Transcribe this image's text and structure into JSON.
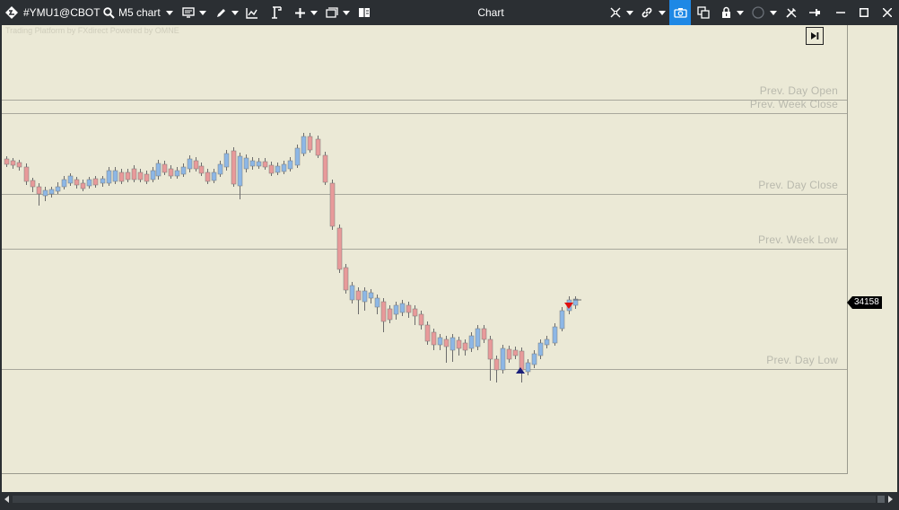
{
  "window": {
    "title": "Chart"
  },
  "toolbar": {
    "symbol": "#YMU1@CBOT",
    "timeframe": "M5 chart"
  },
  "chart": {
    "watermark": "Trading Platform by FXdirect  Powered by OMNE",
    "current_price": "34158",
    "levels": [
      {
        "label": "Prev. Day Open"
      },
      {
        "label": "Prev. Week Close"
      },
      {
        "label": "Prev. Day Close"
      },
      {
        "label": "Prev. Week Low"
      },
      {
        "label": "Prev. Day Low"
      }
    ],
    "colors": {
      "up": "#8db7e6",
      "down": "#e89a9a",
      "background": "#ebe9d6",
      "buy_marker": "#1a1f7a",
      "sell_marker": "#e01010"
    }
  }
}
